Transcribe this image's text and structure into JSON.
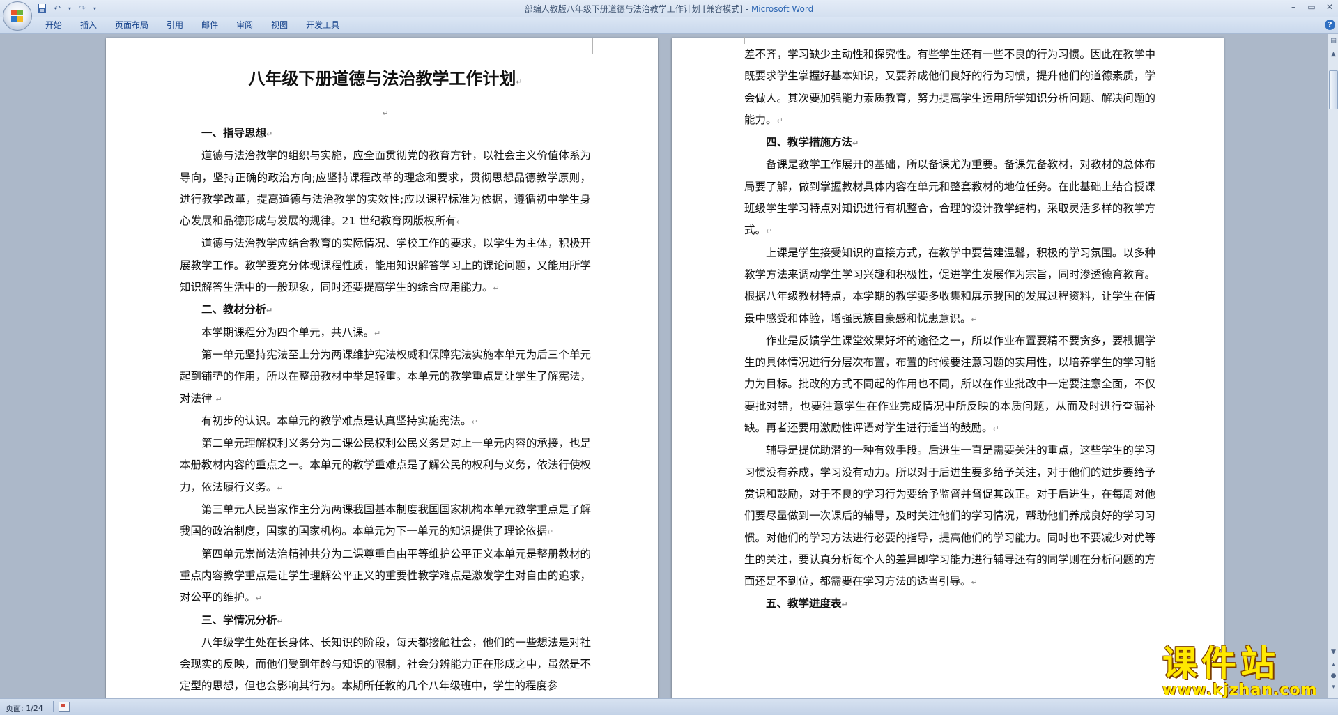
{
  "window": {
    "title": "部编人教版八年级下册道德与法治教学工作计划 [兼容模式]",
    "app_name": "Microsoft Word",
    "controls": [
      "–",
      "▭",
      "✕"
    ]
  },
  "quick_access": {
    "save_icon": "save-icon",
    "undo_icon": "undo-icon",
    "redo_icon": "redo-icon",
    "customize_icon": "chevron-down-icon"
  },
  "ribbon": {
    "tabs": [
      "开始",
      "插入",
      "页面布局",
      "引用",
      "邮件",
      "审阅",
      "视图",
      "开发工具"
    ],
    "help_label": "?"
  },
  "document": {
    "title": "八年级下册道德与法治教学工作计划",
    "para_mark": "↵",
    "page1": {
      "h1": "一、指导思想",
      "p1": "道德与法治教学的组织与实施，应全面贯彻党的教育方针，以社会主义价值体系为导向，坚持正确的政治方向;应坚持课程改革的理念和要求，贯彻思想品德教学原则，进行教学改革，提高道德与法治教学的实效性;应以课程标准为依据，遵循初中学生身心发展和品德形成与发展的规律。21 世纪教育网版权所有",
      "p2": "道德与法治教学应结合教育的实际情况、学校工作的要求，以学生为主体，积极开展教学工作。教学要充分体现课程性质，能用知识解答学习上的课论问题，又能用所学知识解答生活中的一般现象，同时还要提高学生的综合应用能力。",
      "h2": "二、教材分析",
      "p3": "本学期课程分为四个单元，共八课。",
      "p4": "第一单元坚持宪法至上分为两课维护宪法权威和保障宪法实施本单元为后三个单元起到铺垫的作用，所以在整册教材中举足轻重。本单元的教学重点是让学生了解宪法，对法律",
      "p5": "有初步的认识。本单元的教学难点是认真坚持实施宪法。",
      "p6": "第二单元理解权利义务分为二课公民权利公民义务是对上一单元内容的承接，也是本册教材内容的重点之一。本单元的教学重难点是了解公民的权利与义务，依法行使权力，依法履行义务。",
      "p7": "第三单元人民当家作主分为两课我国基本制度我国国家机构本单元教学重点是了解我国的政治制度，国家的国家机构。本单元为下一单元的知识提供了理论依据",
      "p8": "第四单元崇尚法治精神共分为二课尊重自由平等维护公平正义本单元是整册教材的重点内容教学重点是让学生理解公平正义的重要性教学难点是激发学生对自由的追求，对公平的维护。",
      "h3": "三、学情况分析",
      "p9": "八年级学生处在长身体、长知识的阶段，每天都接触社会，他们的一些想法是对社会现实的反映，而他们受到年龄与知识的限制，社会分辨能力正在形成之中，虽然是不定型的思想，但也会影响其行为。本期所任教的几个八年级班中，学生的程度参"
    },
    "page2": {
      "p1": "差不齐，学习缺少主动性和探究性。有些学生还有一些不良的行为习惯。因此在教学中既要求学生掌握好基本知识，又要养成他们良好的行为习惯，提升他们的道德素质，学会做人。其次要加强能力素质教育，努力提高学生运用所学知识分析问题、解决问题的能力。",
      "h4": "四、教学措施方法",
      "p2": "备课是教学工作展开的基础，所以备课尤为重要。备课先备教材，对教材的总体布局要了解，做到掌握教材具体内容在单元和整套教材的地位任务。在此基础上结合授课班级学生学习特点对知识进行有机整合，合理的设计教学结构，采取灵活多样的教学方式。",
      "p3": "上课是学生接受知识的直接方式，在教学中要营建温馨，积极的学习氛围。以多种教学方法来调动学生学习兴趣和积极性，促进学生发展作为宗旨，同时渗透德育教育。根据八年级教材特点，本学期的教学要多收集和展示我国的发展过程资料，让学生在情景中感受和体验，增强民族自豪感和忧患意识。",
      "p4": "作业是反馈学生课堂效果好坏的途径之一，所以作业布置要精不要贪多，要根据学生的具体情况进行分层次布置，布置的时候要注意习题的实用性，以培养学生的学习能力为目标。批改的方式不同起的作用也不同，所以在作业批改中一定要注意全面，不仅要批对错，也要注意学生在作业完成情况中所反映的本质问题，从而及时进行查漏补缺。再者还要用激励性评语对学生进行适当的鼓励。",
      "p5": "辅导是提优助潜的一种有效手段。后进生一直是需要关注的重点，这些学生的学习习惯没有养成，学习没有动力。所以对于后进生要多给予关注，对于他们的进步要给予赏识和鼓励，对于不良的学习行为要给予监督并督促其改正。对于后进生，在每周对他们要尽量做到一次课后的辅导，及时关注他们的学习情况，帮助他们养成良好的学习习惯。对他们的学习方法进行必要的指导，提高他们的学习能力。同时也不要减少对优等生的关注，要认真分析每个人的差异即学习能力进行辅导还有的同学则在分析问题的方面还是不到位，都需要在学习方法的适当引导。",
      "h5": "五、教学进度表"
    }
  },
  "watermark": {
    "name": "课件站",
    "url": "www.kjzhan.com"
  },
  "statusbar": {
    "page_info": "页面: 1/24"
  }
}
